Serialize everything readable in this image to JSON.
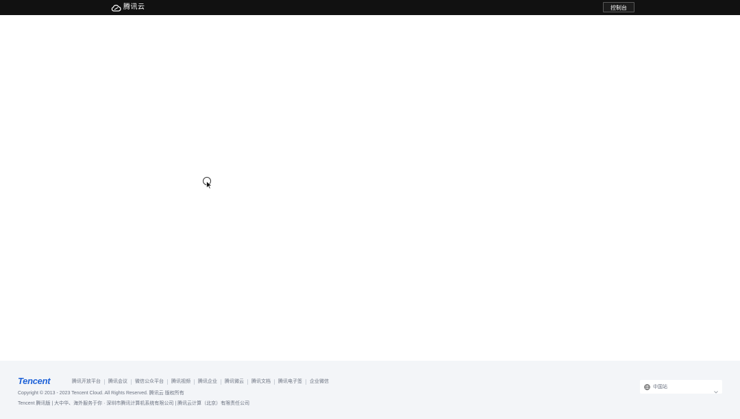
{
  "header": {
    "logo_text": "腾讯云",
    "console_label": "控制台"
  },
  "footer": {
    "brand": "Tencent",
    "links": [
      "腾讯开放平台",
      "腾讯会议",
      "微信公众平台",
      "腾讯视频",
      "腾讯企业",
      "腾讯微云",
      "腾讯文档",
      "腾讯电子签",
      "企业微信"
    ],
    "copyright": "Copyright © 2013 - 2023 Tencent Cloud. All Rights Reserved. 腾讯云 版权所有",
    "company": "Tencent 腾讯版 | 大中华、海外服务于你 · 深圳市腾讯计算机系统有限公司 | 腾讯云计算（北京）有限责任公司",
    "region_label": "中国站"
  },
  "colors": {
    "topbar": "#111111",
    "footer_bg": "#f3f5f8",
    "brand_blue": "#1e62d8"
  }
}
